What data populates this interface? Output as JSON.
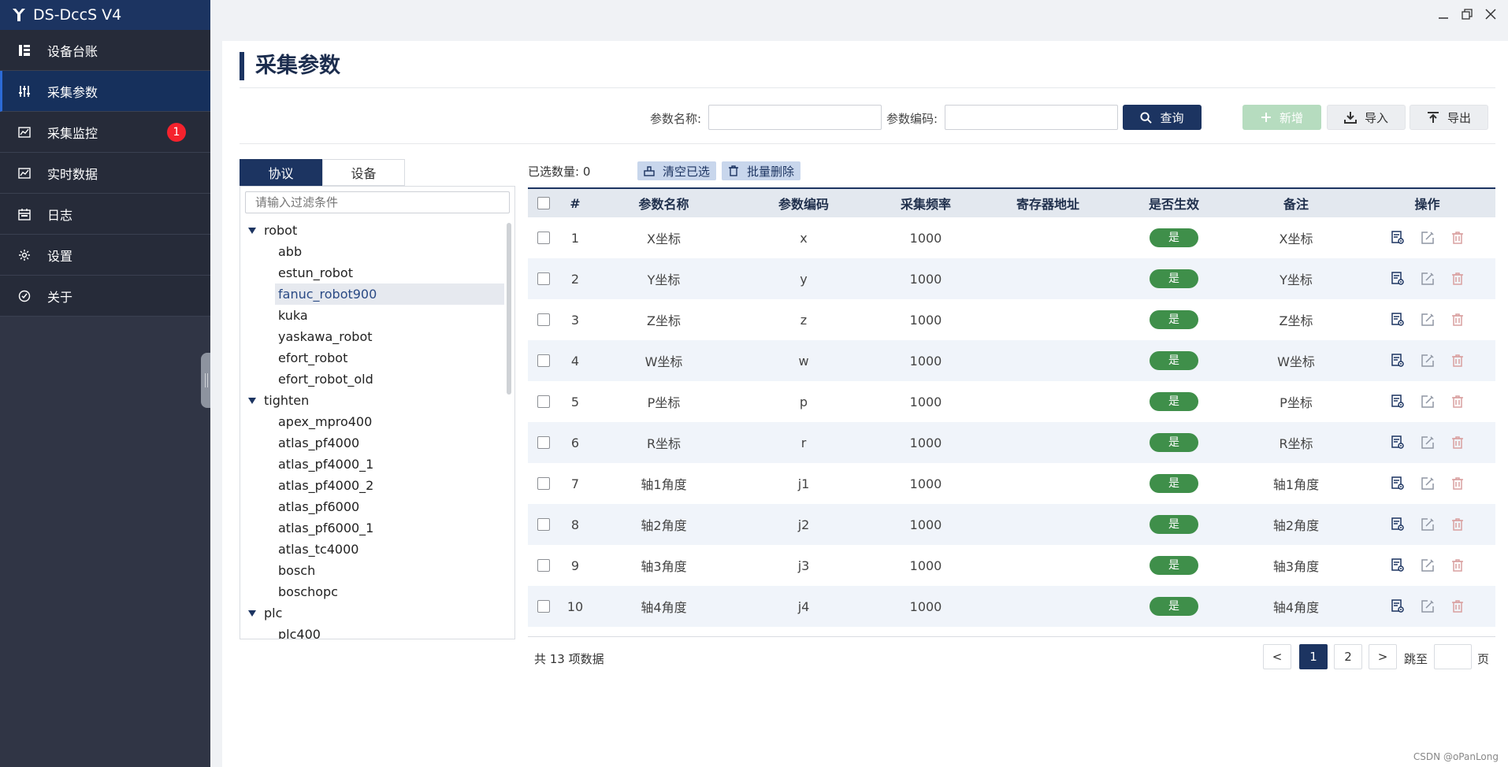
{
  "app": {
    "title": "DS-DccS V4"
  },
  "sidebar": {
    "items": [
      {
        "label": "设备台账",
        "icon": "device-ledger-icon"
      },
      {
        "label": "采集参数",
        "icon": "sliders-icon",
        "active": true
      },
      {
        "label": "采集监控",
        "icon": "chart-icon",
        "badge": "1"
      },
      {
        "label": "实时数据",
        "icon": "chart-icon"
      },
      {
        "label": "日志",
        "icon": "calendar-icon"
      },
      {
        "label": "设置",
        "icon": "gear-icon"
      },
      {
        "label": "关于",
        "icon": "clock-check-icon"
      }
    ]
  },
  "page": {
    "title": "采集参数"
  },
  "search": {
    "name_label": "参数名称:",
    "name_value": "",
    "code_label": "参数编码:",
    "code_value": "",
    "query_label": "查询",
    "add_label": "新增",
    "import_label": "导入",
    "export_label": "导出"
  },
  "tree": {
    "tabs": [
      "协议",
      "设备"
    ],
    "filter_placeholder": "请输入过滤条件",
    "groups": [
      {
        "name": "robot",
        "children": [
          "abb",
          "estun_robot",
          "fanuc_robot900",
          "kuka",
          "yaskawa_robot",
          "efort_robot",
          "efort_robot_old"
        ]
      },
      {
        "name": "tighten",
        "children": [
          "apex_mpro400",
          "atlas_pf4000",
          "atlas_pf4000_1",
          "atlas_pf4000_2",
          "atlas_pf6000",
          "atlas_pf6000_1",
          "atlas_tc4000",
          "bosch",
          "boschopc"
        ]
      },
      {
        "name": "plc",
        "children": [
          "plc400"
        ]
      }
    ],
    "selected": "fanuc_robot900"
  },
  "selection": {
    "label": "已选数量:",
    "count": "0",
    "clear_label": "清空已选",
    "batch_delete_label": "批量删除"
  },
  "table": {
    "columns": [
      "#",
      "参数名称",
      "参数编码",
      "采集频率",
      "寄存器地址",
      "是否生效",
      "备注",
      "操作"
    ],
    "rows": [
      {
        "idx": "1",
        "name": "X坐标",
        "code": "x",
        "freq": "1000",
        "reg": "",
        "effective": "是",
        "note": "X坐标"
      },
      {
        "idx": "2",
        "name": "Y坐标",
        "code": "y",
        "freq": "1000",
        "reg": "",
        "effective": "是",
        "note": "Y坐标"
      },
      {
        "idx": "3",
        "name": "Z坐标",
        "code": "z",
        "freq": "1000",
        "reg": "",
        "effective": "是",
        "note": "Z坐标"
      },
      {
        "idx": "4",
        "name": "W坐标",
        "code": "w",
        "freq": "1000",
        "reg": "",
        "effective": "是",
        "note": "W坐标"
      },
      {
        "idx": "5",
        "name": "P坐标",
        "code": "p",
        "freq": "1000",
        "reg": "",
        "effective": "是",
        "note": "P坐标"
      },
      {
        "idx": "6",
        "name": "R坐标",
        "code": "r",
        "freq": "1000",
        "reg": "",
        "effective": "是",
        "note": "R坐标"
      },
      {
        "idx": "7",
        "name": "轴1角度",
        "code": "j1",
        "freq": "1000",
        "reg": "",
        "effective": "是",
        "note": "轴1角度"
      },
      {
        "idx": "8",
        "name": "轴2角度",
        "code": "j2",
        "freq": "1000",
        "reg": "",
        "effective": "是",
        "note": "轴2角度"
      },
      {
        "idx": "9",
        "name": "轴3角度",
        "code": "j3",
        "freq": "1000",
        "reg": "",
        "effective": "是",
        "note": "轴3角度"
      },
      {
        "idx": "10",
        "name": "轴4角度",
        "code": "j4",
        "freq": "1000",
        "reg": "",
        "effective": "是",
        "note": "轴4角度"
      }
    ]
  },
  "pagination": {
    "total_text": "共 13 项数据",
    "prev": "<",
    "pages": [
      "1",
      "2"
    ],
    "current": "1",
    "next": ">",
    "jump_label": "跳至",
    "jump_value": "",
    "page_suffix": "页"
  },
  "watermark": "CSDN @oPanLong",
  "colors": {
    "primary": "#1c3461",
    "sidebar": "#303545",
    "success": "#3f8f4a",
    "badge": "#f5222d"
  }
}
